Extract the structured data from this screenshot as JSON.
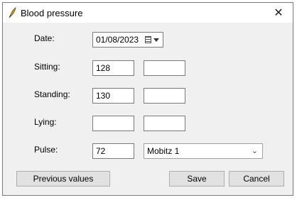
{
  "window": {
    "title": "Blood pressure",
    "close_glyph": "✕",
    "icon": "quill-app-icon"
  },
  "form": {
    "date_label": "Date:",
    "date_value": "01/08/2023",
    "sitting_label": "Sitting:",
    "sitting_value": "128",
    "sitting_value2": "",
    "standing_label": "Standing:",
    "standing_value": "130",
    "standing_value2": "",
    "lying_label": "Lying:",
    "lying_value": "",
    "lying_value2": "",
    "pulse_label": "Pulse:",
    "pulse_value": "72",
    "pulse_type": "Mobitz 1"
  },
  "buttons": {
    "previous": "Previous values",
    "save": "Save",
    "cancel": "Cancel"
  },
  "colors": {
    "titlebar": "#ffffff",
    "client": "#f0f0f0",
    "button": "#e1e1e1"
  }
}
